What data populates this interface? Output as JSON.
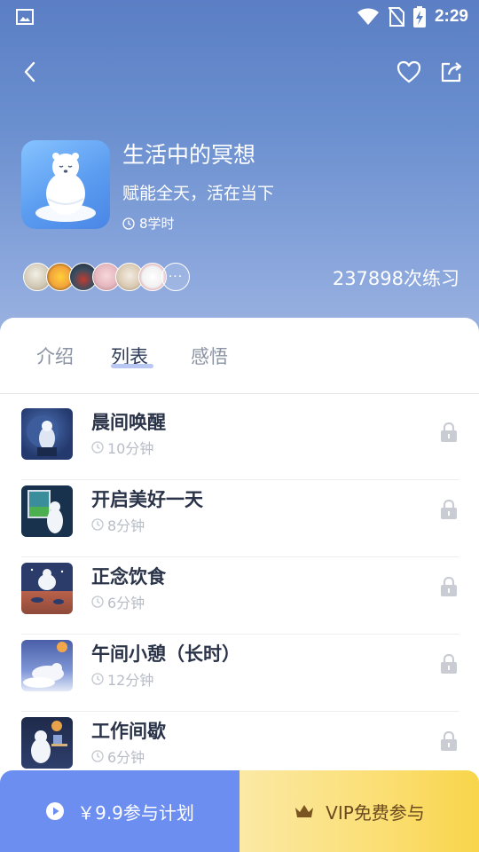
{
  "status_bar": {
    "time": "2:29"
  },
  "course": {
    "title": "生活中的冥想",
    "subtitle": "赋能全天，活在当下",
    "duration": "8学时",
    "practice_count": "237898次练习"
  },
  "participants": {
    "avatar_colors": [
      "#d9d2c2",
      "#f2a33a",
      "#3b4d5f",
      "#e6b7be",
      "#d8c8b0",
      "#f1f1f1"
    ],
    "more_label": "···"
  },
  "tabs": [
    {
      "label": "介绍",
      "active": false
    },
    {
      "label": "列表",
      "active": true
    },
    {
      "label": "感悟",
      "active": false
    }
  ],
  "lessons": [
    {
      "title": "晨间唤醒",
      "duration": "10分钟",
      "locked": true,
      "thumb_bg": "#243a6e"
    },
    {
      "title": "开启美好一天",
      "duration": "8分钟",
      "locked": true,
      "thumb_bg": "#18324d"
    },
    {
      "title": "正念饮食",
      "duration": "6分钟",
      "locked": true,
      "thumb_bg": "#2b3c6a"
    },
    {
      "title": "午间小憩（长时）",
      "duration": "12分钟",
      "locked": true,
      "thumb_bg": "#4a5fa8"
    },
    {
      "title": "工作间歇",
      "duration": "6分钟",
      "locked": true,
      "thumb_bg": "#1f2a4a"
    }
  ],
  "actions": {
    "plan_label": "￥9.9参与计划",
    "vip_label": "VIP免费参与"
  },
  "colors": {
    "hero_top": "#5b7ec4",
    "plan_button": "#6c8ef0",
    "vip_button": "#fbde73",
    "title_text": "#2a3348"
  }
}
